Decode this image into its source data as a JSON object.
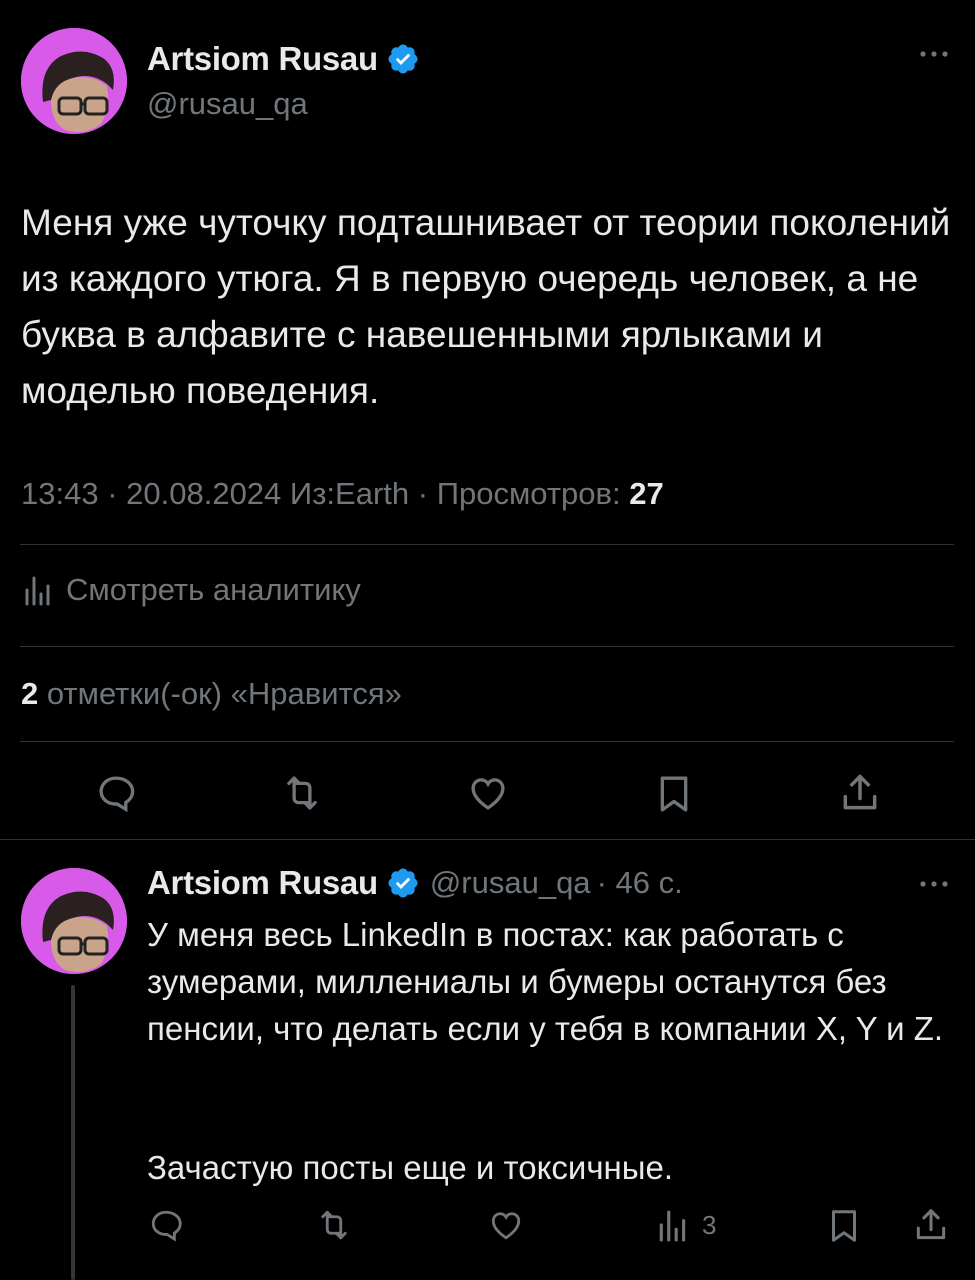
{
  "colors": {
    "background": "#000000",
    "text": "#e7e9ea",
    "muted": "#71767b",
    "accent": "#1d9bf0",
    "avatar_bg": "#d85ae8"
  },
  "main_tweet": {
    "author_name": "Artsiom Rusau",
    "author_handle": "@rusau_qa",
    "more_icon": "more-dots-icon",
    "text": "Меня уже чуточку подташнивает от теории поколений из каждого утюга. Я в первую очередь человек, а не буква в алфавите с навешенными ярлыками и моделью поведения.",
    "time": "13:43",
    "date": "20.08.2024",
    "source": "Из:Earth",
    "views_label": "Просмотров:",
    "views_count": "27",
    "analytics_label": "Смотреть аналитику",
    "likes_count": "2",
    "likes_label": "отметки(-ок) «Нравится»",
    "actions": [
      "reply-icon",
      "retweet-icon",
      "like-icon",
      "bookmark-icon",
      "share-icon"
    ]
  },
  "reply_tweet": {
    "author_name": "Artsiom Rusau",
    "author_handle": "@rusau_qa",
    "time_ago": "· 46 с.",
    "paragraph1": "У меня весь LinkedIn в постах: как работать с зумерами, миллениалы и бумеры останутся без пенсии, что делать если у тебя в компании X, Y и Z.",
    "paragraph2": "Зачастую посты еще и токсичные.",
    "views_count": "3",
    "actions": [
      "reply-icon",
      "retweet-icon",
      "like-icon",
      "views-icon",
      "bookmark-icon",
      "share-icon"
    ]
  }
}
